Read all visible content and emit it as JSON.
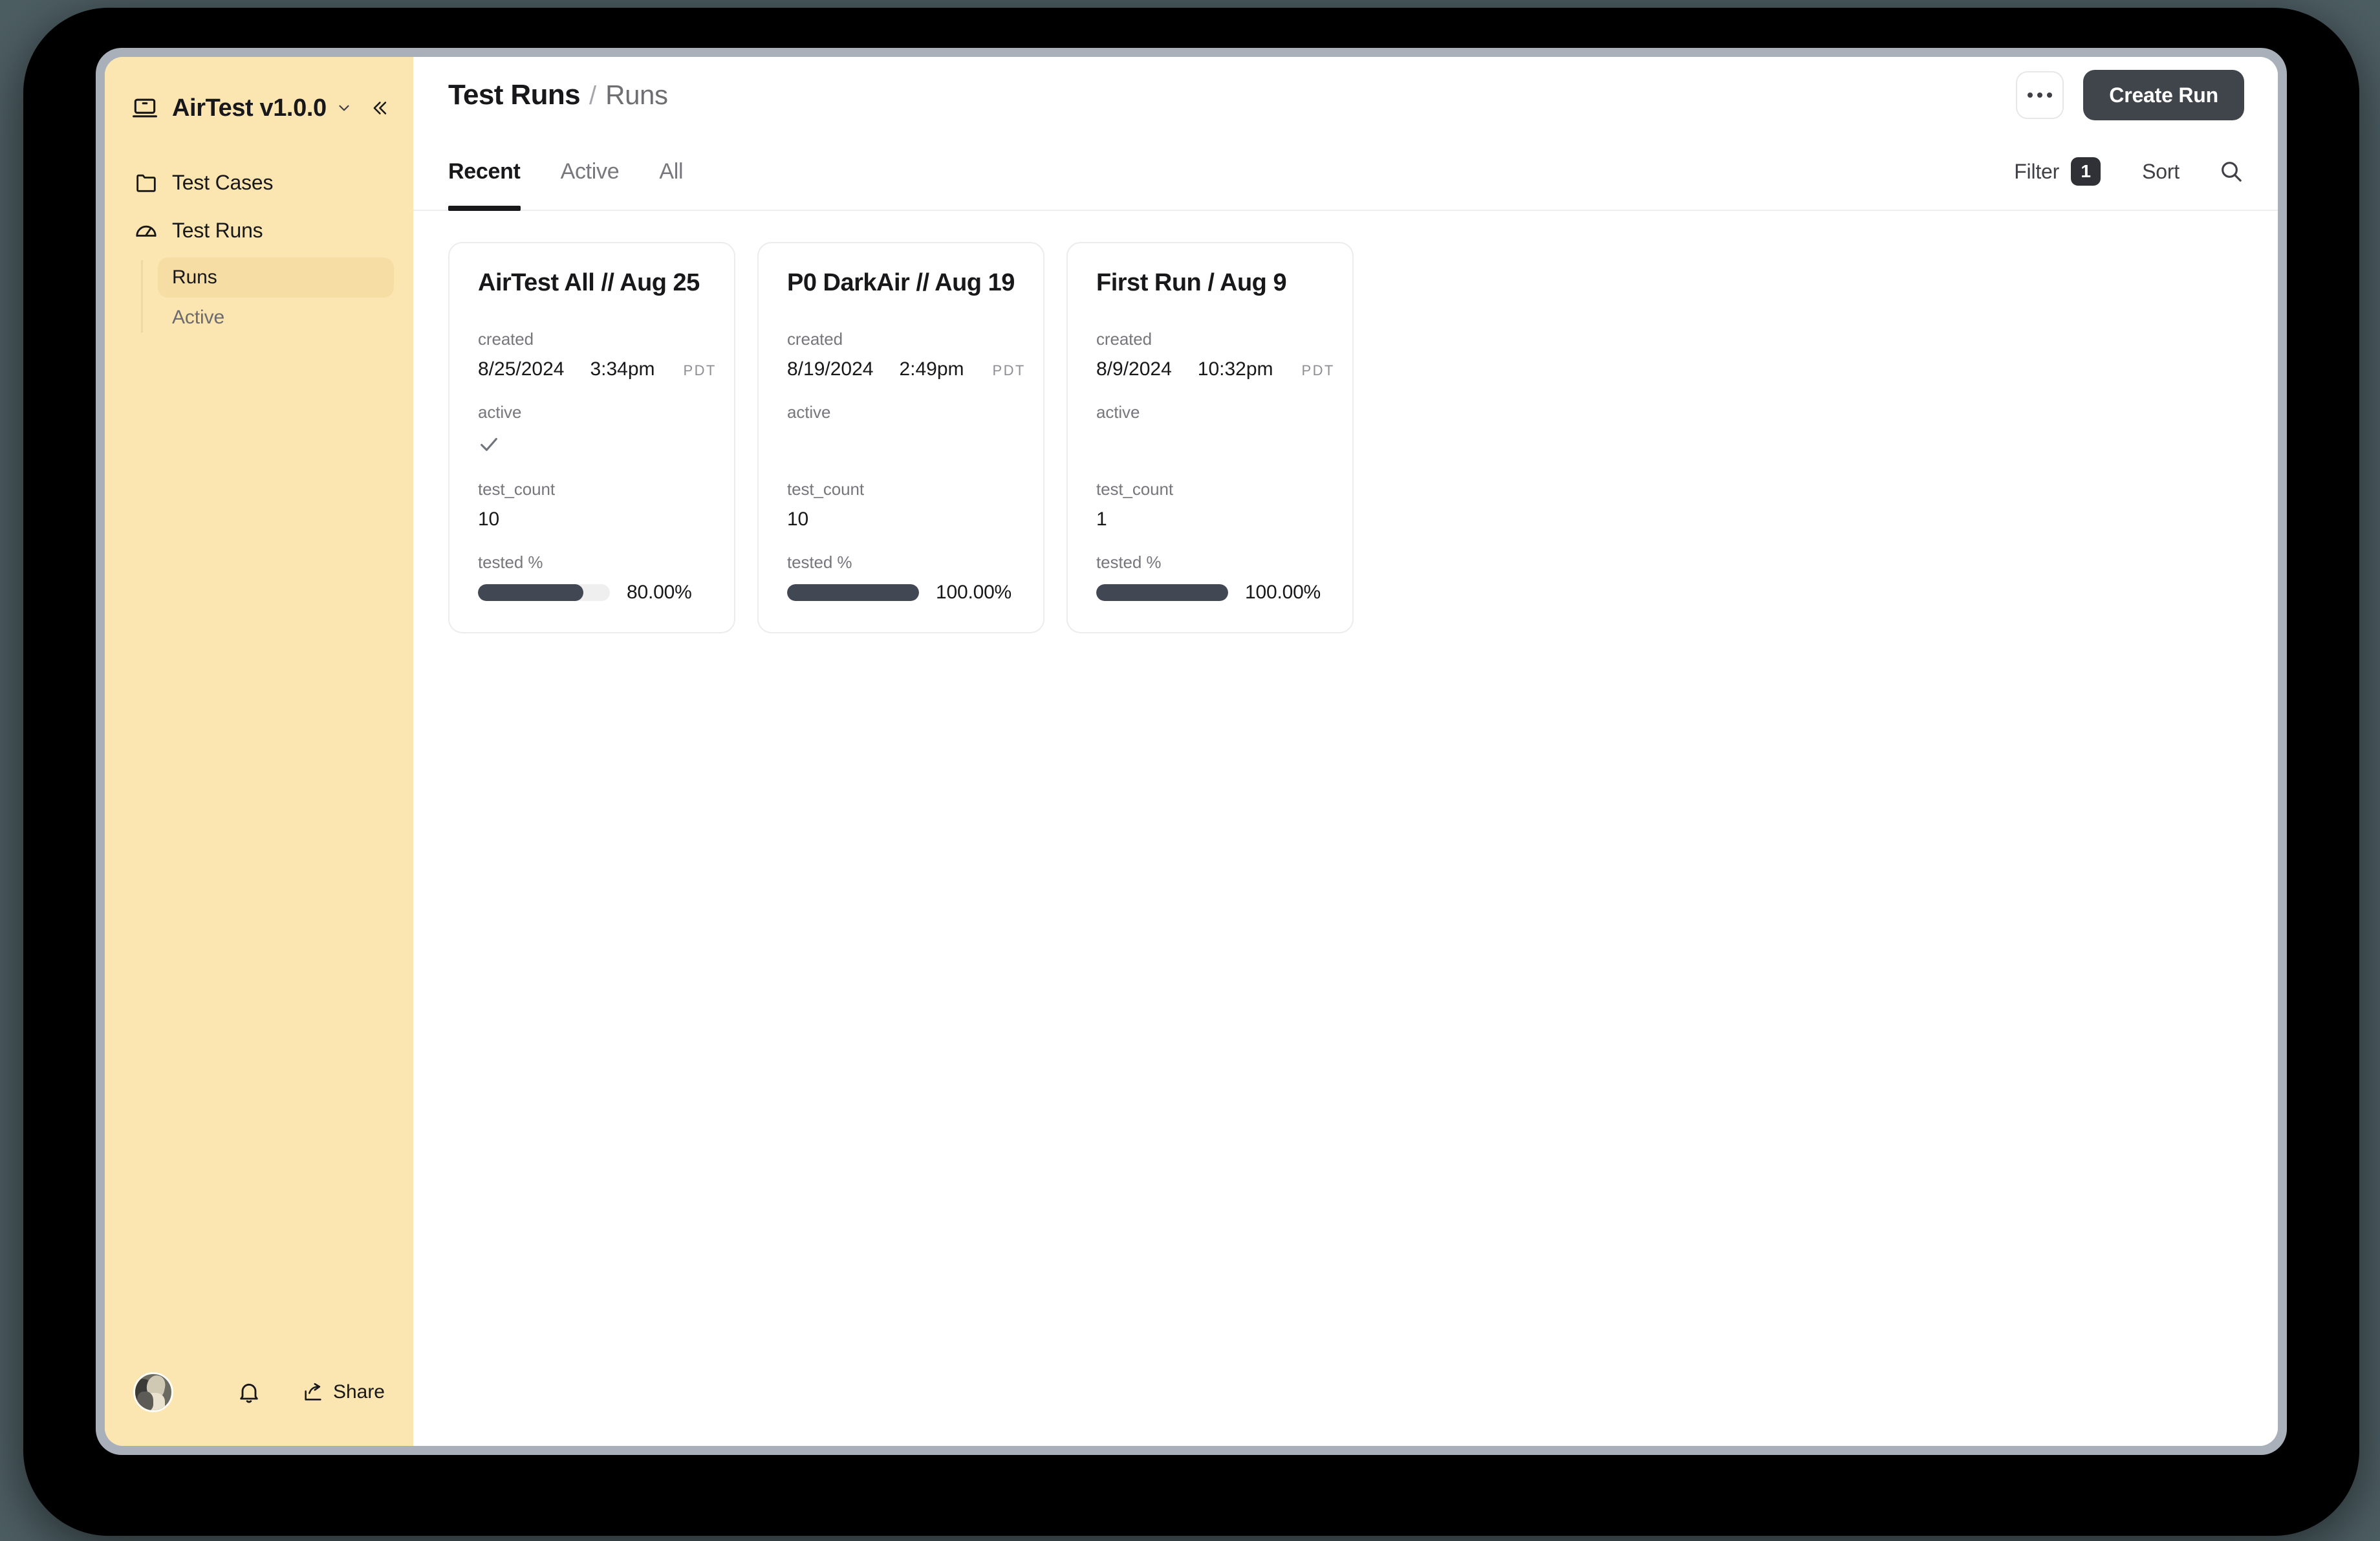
{
  "sidebar": {
    "brand": {
      "name": "AirTest v1.0.0",
      "icon": "laptop-icon",
      "chevron": "chevron-down-icon",
      "collapse": "collapse-sidebar-icon"
    },
    "nav": [
      {
        "label": "Test Cases",
        "icon": "folder-icon",
        "selected": false
      },
      {
        "label": "Test Runs",
        "icon": "gauge-icon",
        "selected": false
      }
    ],
    "subnav": [
      {
        "label": "Runs",
        "selected": true
      },
      {
        "label": "Active",
        "selected": false
      }
    ],
    "footer": {
      "avatar": "user-avatar",
      "bell": "bell-icon",
      "share_icon": "share-icon",
      "share_label": "Share"
    }
  },
  "header": {
    "breadcrumb_root": "Test Runs",
    "breadcrumb_separator": "/",
    "breadcrumb_current": "Runs",
    "more_button": "more-options",
    "create_run_label": "Create Run"
  },
  "tabbar": {
    "tabs": [
      {
        "label": "Recent",
        "active": true
      },
      {
        "label": "Active",
        "active": false
      },
      {
        "label": "All",
        "active": false
      }
    ],
    "filter_label": "Filter",
    "filter_count": "1",
    "sort_label": "Sort",
    "search_icon": "search-icon"
  },
  "field_labels": {
    "created": "created",
    "active": "active",
    "test_count": "test_count",
    "tested_pct": "tested %"
  },
  "cards": [
    {
      "title": "AirTest All // Aug 25",
      "created_date": "8/25/2024",
      "created_time": "3:34pm",
      "timezone": "PDT",
      "active": true,
      "test_count": "10",
      "tested_pct_label": "80.00%",
      "tested_pct_value": 80
    },
    {
      "title": "P0 DarkAir // Aug 19",
      "created_date": "8/19/2024",
      "created_time": "2:49pm",
      "timezone": "PDT",
      "active": false,
      "test_count": "10",
      "tested_pct_label": "100.00%",
      "tested_pct_value": 100
    },
    {
      "title": "First Run / Aug 9",
      "created_date": "8/9/2024",
      "created_time": "10:32pm",
      "timezone": "PDT",
      "active": false,
      "test_count": "1",
      "tested_pct_label": "100.00%",
      "tested_pct_value": 100
    }
  ],
  "colors": {
    "sidebar_bg": "#fbe5b0",
    "sidebar_selected": "#f6dda4",
    "accent_dark": "#3f454b",
    "progress_fill": "#414753",
    "progress_track": "#efeff0",
    "badge_bg": "#2f3137"
  }
}
